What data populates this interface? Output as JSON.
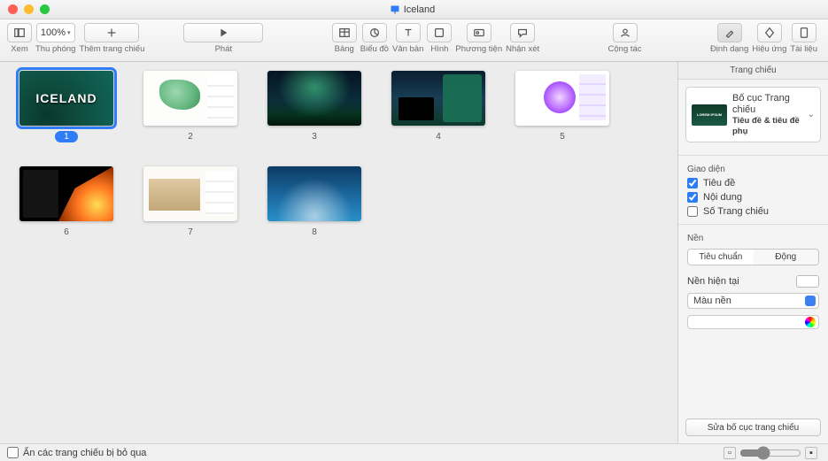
{
  "window": {
    "title": "Iceland"
  },
  "toolbar": {
    "view": {
      "label": "Xem"
    },
    "zoom": {
      "label": "Thu phóng",
      "value": "100%"
    },
    "addSlide": {
      "label": "Thêm trang chiếu"
    },
    "play": {
      "label": "Phát"
    },
    "table": {
      "label": "Bảng"
    },
    "chart": {
      "label": "Biểu đồ"
    },
    "text": {
      "label": "Văn bản"
    },
    "shape": {
      "label": "Hình"
    },
    "media": {
      "label": "Phương tiện"
    },
    "comment": {
      "label": "Nhận xét"
    },
    "collab": {
      "label": "Cộng tác"
    },
    "format": {
      "label": "Định dạng"
    },
    "animate": {
      "label": "Hiệu ứng"
    },
    "document": {
      "label": "Tài liệu"
    }
  },
  "slides": [
    {
      "n": "1"
    },
    {
      "n": "2"
    },
    {
      "n": "3"
    },
    {
      "n": "4"
    },
    {
      "n": "5"
    },
    {
      "n": "6"
    },
    {
      "n": "7"
    },
    {
      "n": "8"
    }
  ],
  "inspector": {
    "tab": "Trang chiếu",
    "layout": {
      "caption": "Bố cục Trang chiếu",
      "name": "Tiêu đề & tiêu đề phụ"
    },
    "appearance": {
      "heading": "Giao diện",
      "title": {
        "label": "Tiêu đề",
        "checked": true
      },
      "body": {
        "label": "Nội dung",
        "checked": true
      },
      "number": {
        "label": "Số Trang chiếu",
        "checked": false
      }
    },
    "background": {
      "heading": "Nền",
      "standard": "Tiêu chuẩn",
      "dynamic": "Động",
      "current": "Nền hiện tại",
      "fillType": "Màu nền"
    },
    "editMaster": "Sửa bố cục trang chiếu"
  },
  "footer": {
    "skip": "Ẩn các trang chiếu bị bỏ qua"
  }
}
